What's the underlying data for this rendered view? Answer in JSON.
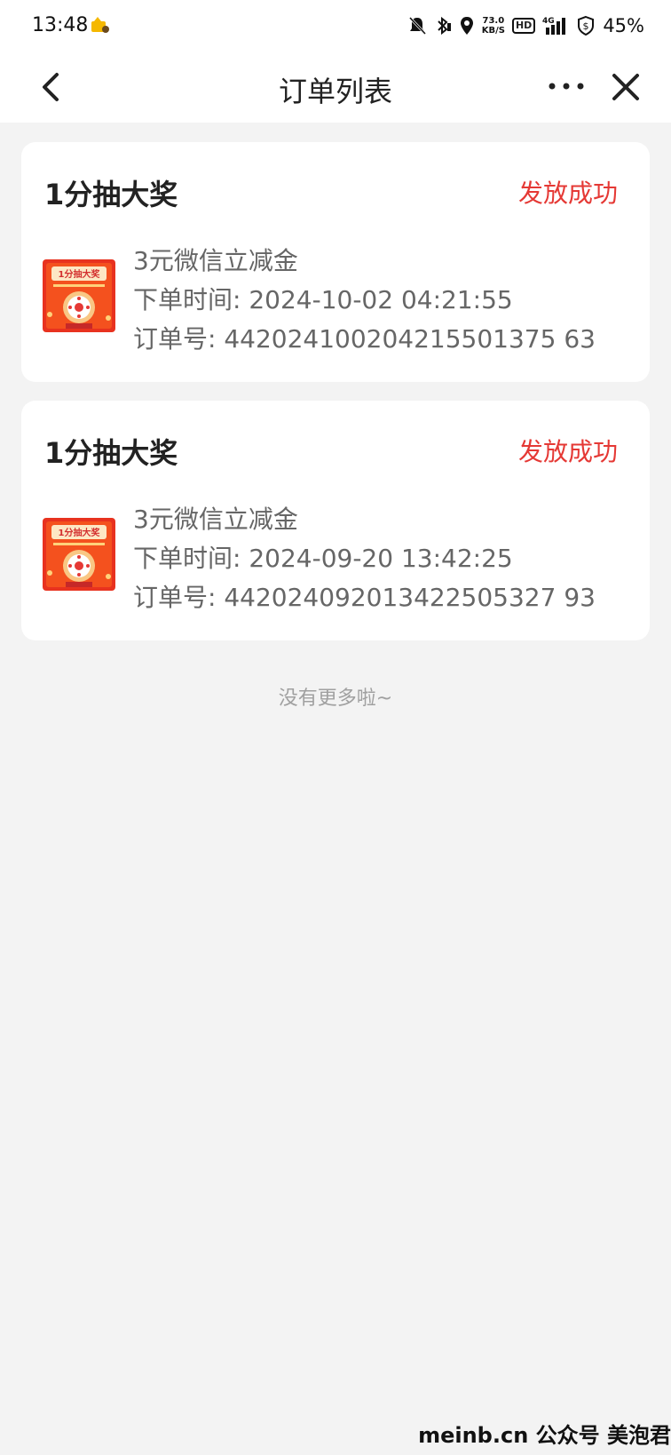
{
  "status_bar": {
    "time": "13:48",
    "net_speed_value": "73.0",
    "net_speed_unit": "KB/S",
    "hd": "HD",
    "network": "4G",
    "battery": "45%"
  },
  "nav": {
    "title": "订单列表"
  },
  "orders": [
    {
      "title": "1分抽大奖",
      "status": "发放成功",
      "product": "3元微信立减金",
      "order_time_label": "下单时间: 2024-10-02 04:21:55",
      "order_no_label": "订单号: 442024100204215501375 63",
      "thumb_text": "1分抽大奖"
    },
    {
      "title": "1分抽大奖",
      "status": "发放成功",
      "product": "3元微信立减金",
      "order_time_label": "下单时间: 2024-09-20 13:42:25",
      "order_no_label": "订单号: 442024092013422505327 93",
      "thumb_text": "1分抽大奖"
    }
  ],
  "footer_text": "没有更多啦~",
  "watermark": "meinb.cn  公众号 美泡君",
  "colors": {
    "accent_red": "#e53935",
    "background": "#f3f3f3"
  }
}
